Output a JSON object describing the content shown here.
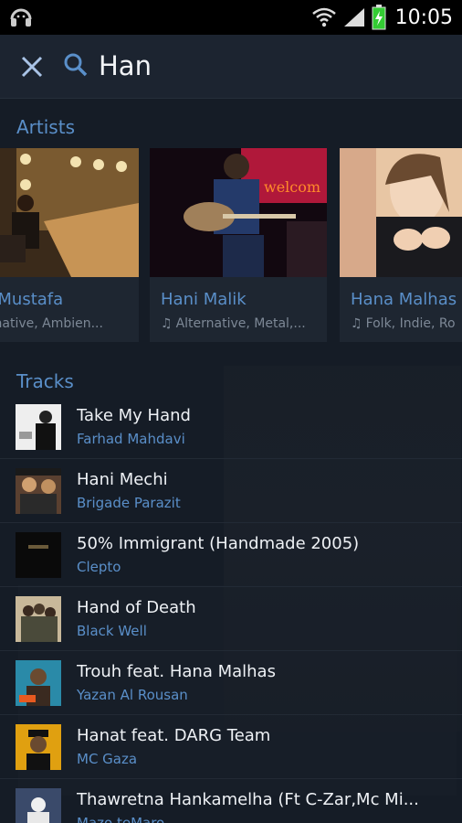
{
  "status_bar": {
    "time": "10:05"
  },
  "search": {
    "query": "Han"
  },
  "artists": {
    "heading": "Artists",
    "items": [
      {
        "name": "Ayay Mustafa",
        "name_visible": "ay Mustafa",
        "genre": "Alternative, Ambient...",
        "genre_visible": "lternative, Ambien..."
      },
      {
        "name": "Hani Malik",
        "genre": "Alternative, Metal,..."
      },
      {
        "name": "Hana Malhas",
        "genre": "Folk, Indie, Ro"
      }
    ]
  },
  "tracks": {
    "heading": "Tracks",
    "items": [
      {
        "title": "Take My Hand",
        "artist": "Farhad Mahdavi"
      },
      {
        "title": "Hani Mechi",
        "artist": "Brigade Parazit"
      },
      {
        "title": "50% Immigrant (Handmade 2005)",
        "artist": "Clepto"
      },
      {
        "title": "Hand of Death",
        "artist": "Black Well"
      },
      {
        "title": "Trouh feat. Hana Malhas",
        "artist": "Yazan Al Rousan"
      },
      {
        "title": "Hanat feat. DARG Team",
        "artist": "MC Gaza"
      },
      {
        "title": "Thawretna Hankamelha (Ft C-Zar,Mc Mi...",
        "artist": "Mazo teMaro"
      }
    ]
  },
  "colors": {
    "background": "#151c26",
    "accent": "#5a8fc9",
    "battery": "#33cc33"
  }
}
